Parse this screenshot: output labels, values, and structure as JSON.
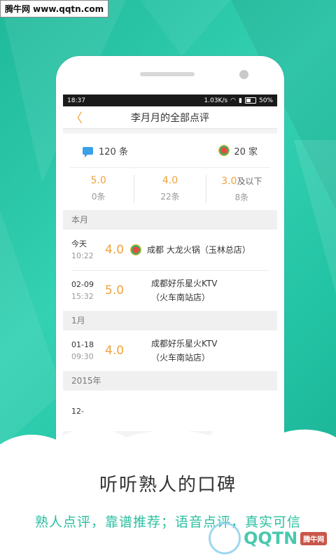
{
  "watermark": "腾牛网 www.qqtn.com",
  "status": {
    "time": "18:37",
    "speed": "1.03K/s",
    "battery": "50%"
  },
  "nav": {
    "back": "〈",
    "title": "李月月的全部点评"
  },
  "summary": {
    "reviews": "120 条",
    "shops": "20 家"
  },
  "ratings": [
    {
      "value": "5.0",
      "suffix": "",
      "count": "0条"
    },
    {
      "value": "4.0",
      "suffix": "",
      "count": "22条"
    },
    {
      "value": "3.0",
      "suffix": "及以下",
      "count": "8条"
    }
  ],
  "sections": [
    {
      "label": "本月"
    },
    {
      "label": "1月"
    },
    {
      "label": "2015年"
    }
  ],
  "items": [
    {
      "date": "今天",
      "time": "10:22",
      "score": "4.0",
      "shop": "成都 大龙火锅（玉林总店）",
      "shop2": ""
    },
    {
      "date": "02-09",
      "time": "15:32",
      "score": "5.0",
      "shop": "成都好乐星火KTV",
      "shop2": "（火车南站店）"
    },
    {
      "date": "01-18",
      "time": "09:30",
      "score": "4.0",
      "shop": "成都好乐星火KTV",
      "shop2": "（火车南站店）"
    },
    {
      "date": "12-",
      "time": "",
      "score": "",
      "shop": "",
      "shop2": ""
    }
  ],
  "slogan": "听听熟人的口碑",
  "subtitle": "熟人点评，靠谱推荐；语音点评，真实可信",
  "logo": {
    "text": "QQTN",
    "tag": "腾牛网"
  },
  "colors": {
    "accent": "#f0a23c",
    "brand": "#2bbfa0"
  }
}
